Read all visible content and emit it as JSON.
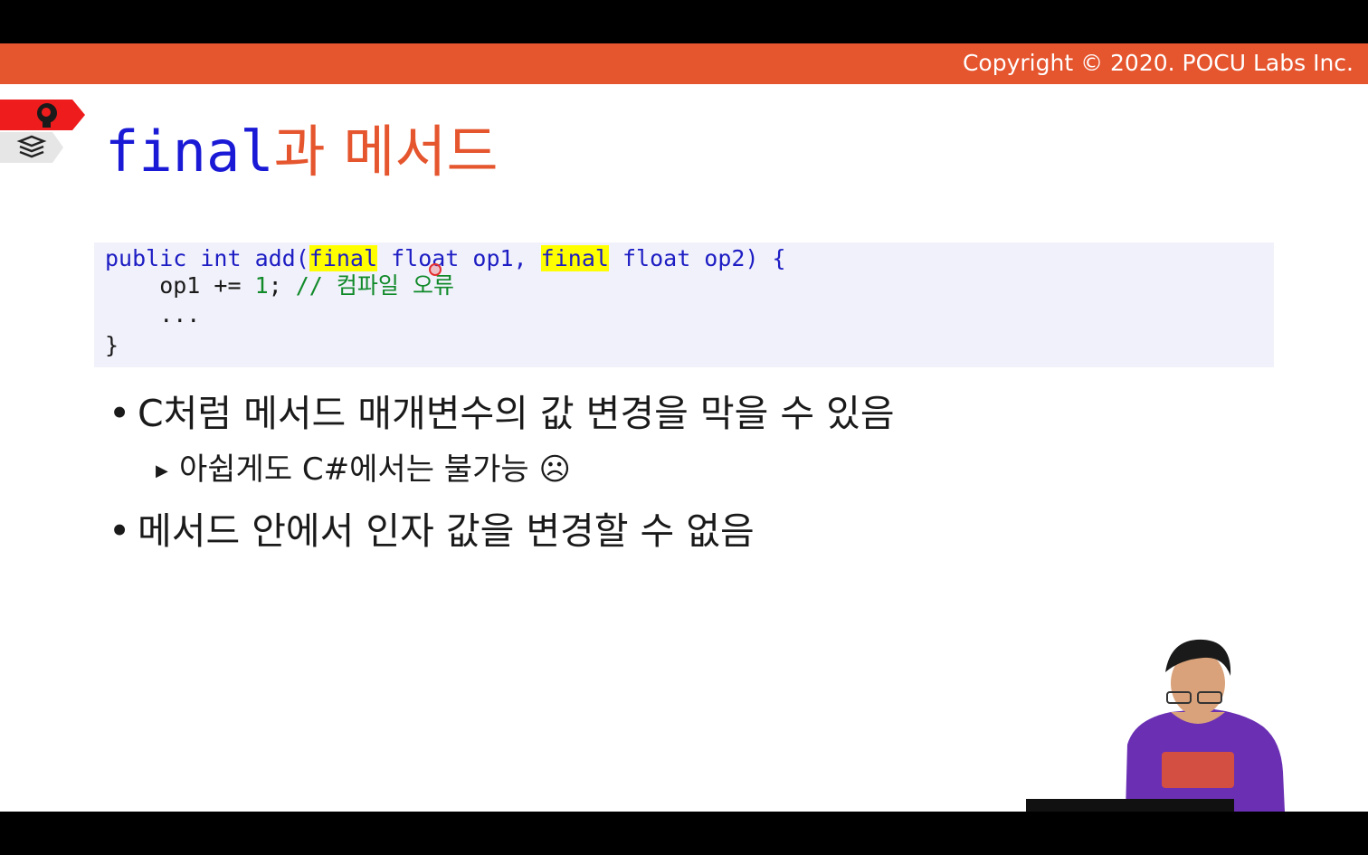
{
  "header": {
    "copyright": "Copyright © 2020. POCU Labs Inc."
  },
  "icons": {
    "red_tag": "brain-head-icon",
    "gray_tag": "stack-layers-icon"
  },
  "title": {
    "keyword": "final",
    "rest": "과 메서드"
  },
  "code": {
    "line1": {
      "p1": "public int add(",
      "kw1": "final",
      "p2": " float op1, ",
      "kw2": "final",
      "p3": " float op2) {"
    },
    "line2": {
      "indent": "    op1 += ",
      "num": "1",
      "semi": "; ",
      "comment": "// 컴파일 오류"
    },
    "line3": "    ...",
    "line4": "}"
  },
  "bullets": {
    "b1": "C처럼 메서드 매개변수의 값 변경을 막을 수 있음",
    "sub1": "아쉽게도 C#에서는 불가능 ☹",
    "b2": "메서드 안에서 인자 값을 변경할 수 없음"
  },
  "colors": {
    "accent": "#e5552e",
    "keyword_blue": "#1d1dc4",
    "comment_green": "#118a2a",
    "highlight": "#ffff00"
  }
}
